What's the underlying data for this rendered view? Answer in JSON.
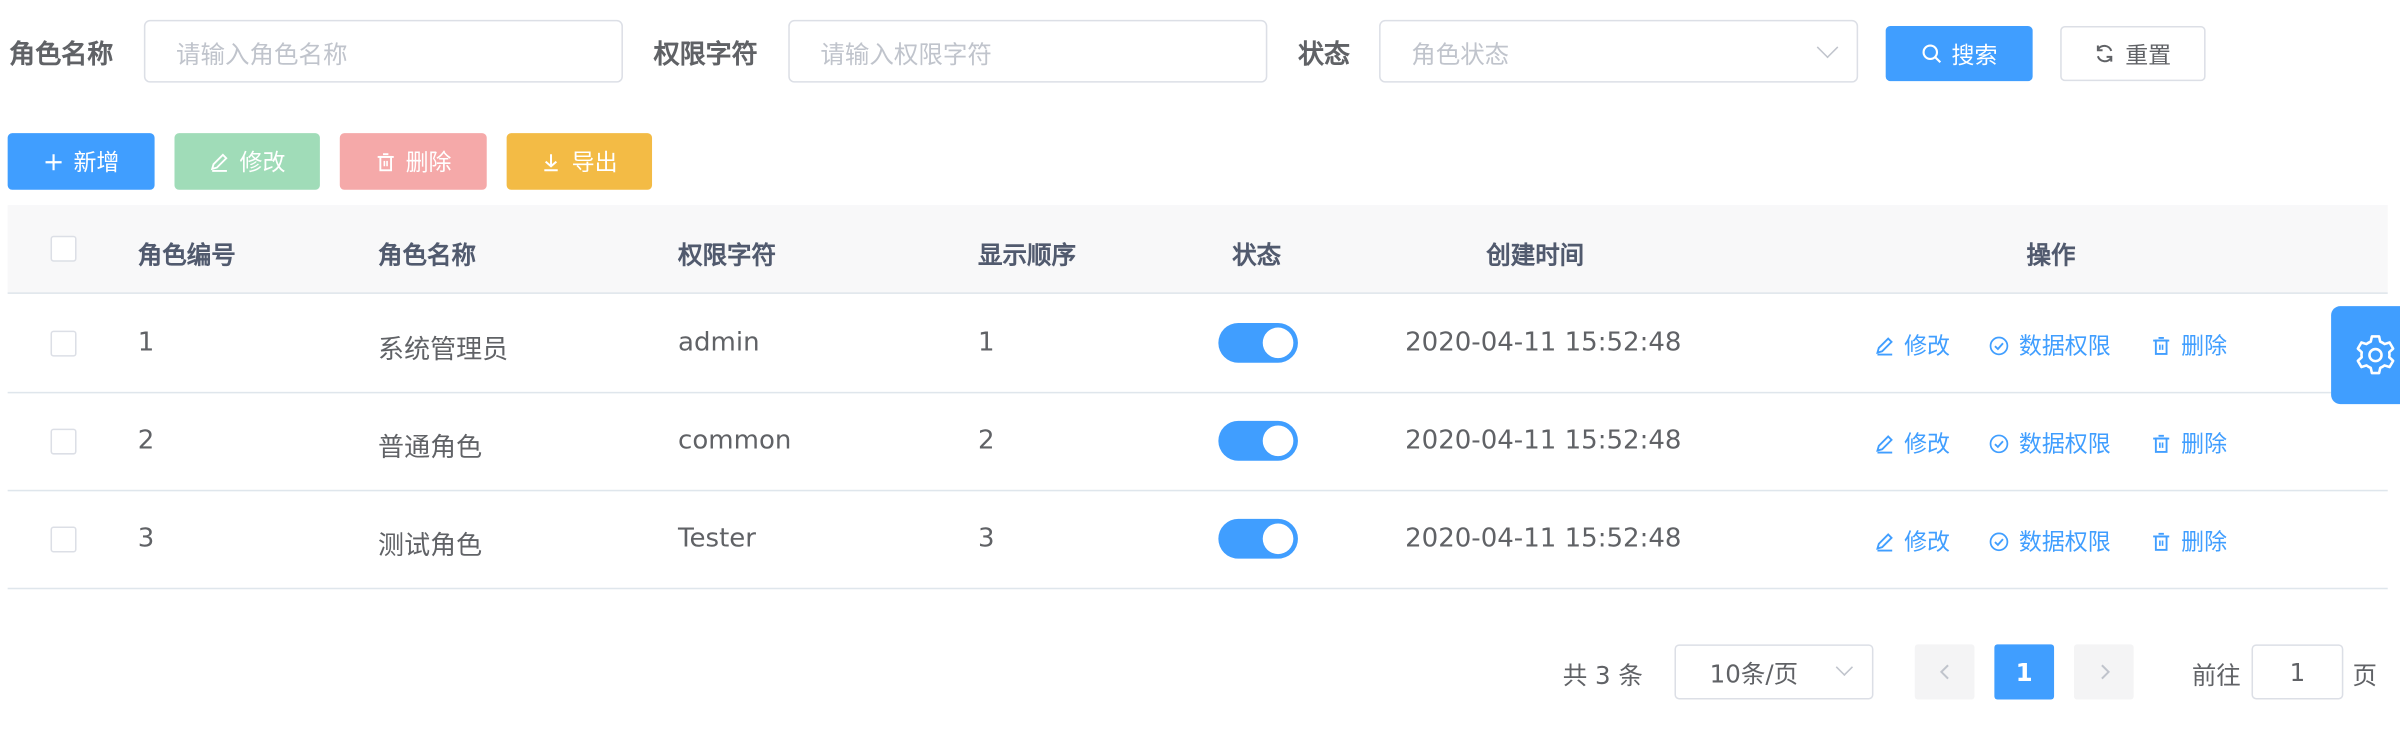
{
  "search": {
    "role_name_label": "角色名称",
    "role_name_placeholder": "请输入角色名称",
    "perm_label": "权限字符",
    "perm_placeholder": "请输入权限字符",
    "status_label": "状态",
    "status_placeholder": "角色状态",
    "search_button": "搜索",
    "reset_button": "重置"
  },
  "toolbar": {
    "add": "新增",
    "edit": "修改",
    "delete": "删除",
    "export": "导出"
  },
  "table": {
    "columns": [
      "角色编号",
      "角色名称",
      "权限字符",
      "显示顺序",
      "状态",
      "创建时间",
      "操作"
    ],
    "rows": [
      {
        "id": "1",
        "name": "系统管理员",
        "key": "admin",
        "sort": "1",
        "enabled": true,
        "created": "2020-04-11 15:52:48"
      },
      {
        "id": "2",
        "name": "普通角色",
        "key": "common",
        "sort": "2",
        "enabled": true,
        "created": "2020-04-11 15:52:48"
      },
      {
        "id": "3",
        "name": "测试角色",
        "key": "Tester",
        "sort": "3",
        "enabled": true,
        "created": "2020-04-11 15:52:48"
      }
    ],
    "actions": {
      "edit": "修改",
      "data_scope": "数据权限",
      "delete": "删除"
    }
  },
  "pagination": {
    "total_text": "共 3 条",
    "page_size": "10条/页",
    "current_page": "1",
    "goto_label": "前往",
    "goto_value": "1",
    "page_unit": "页"
  },
  "colors": {
    "primary": "#409eff",
    "success_disabled": "#a0dcb8",
    "danger_disabled": "#f5a9a9",
    "warning": "#f3bb45"
  }
}
